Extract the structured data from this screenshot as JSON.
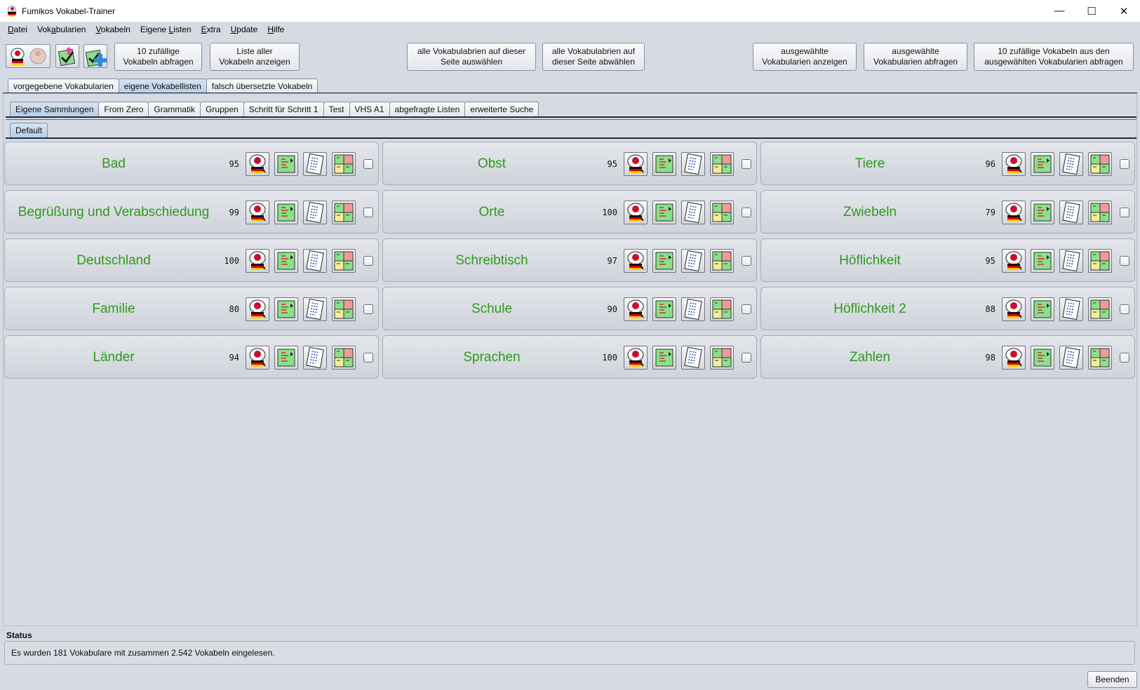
{
  "window": {
    "title": "Fumikos Vokabel-Trainer",
    "controls": [
      "—",
      "☐",
      "✕"
    ]
  },
  "menu": [
    {
      "pre": "",
      "u": "D",
      "post": "atei"
    },
    {
      "pre": "Vok",
      "u": "a",
      "post": "bularien"
    },
    {
      "pre": "",
      "u": "V",
      "post": "okabeln"
    },
    {
      "pre": "Eigene ",
      "u": "L",
      "post": "isten"
    },
    {
      "pre": "",
      "u": "E",
      "post": "xtra"
    },
    {
      "pre": "",
      "u": "U",
      "post": "pdate"
    },
    {
      "pre": "",
      "u": "H",
      "post": "ilfe"
    }
  ],
  "toolbar": {
    "icons": [
      "translate-quiz-icon",
      "import-icon",
      "add-list-icon"
    ],
    "random_quiz": [
      "10 zufällige",
      "Vokabeln abfragen"
    ],
    "list_all": [
      "Liste aller",
      "Vokabeln anzeigen"
    ],
    "select_all": [
      "alle Vokabulabrien auf dieser",
      "Seite auswählen"
    ],
    "deselect_all": [
      "alle Vokabulabrien auf",
      "dieser Seite abwählen"
    ],
    "show_selected": [
      "ausgewählte",
      "Vokabularien anzeigen"
    ],
    "quiz_selected": [
      "ausgewählte",
      "Vokabularien abfragen"
    ],
    "random_selected": [
      "10 zufällige Vokabeln aus den",
      "ausgewählten Vokabularien abfragen"
    ]
  },
  "main_tabs": [
    "vorgegebene Vokabularien",
    "eigene Vokabellisten",
    "falsch übersetzte Vokabeln"
  ],
  "main_tab_active": 1,
  "sub_tabs": [
    "Eigene Sammlungen",
    "From Zero",
    "Grammatik",
    "Gruppen",
    "Schritt für Schritt 1",
    "Test",
    "VHS A1",
    "abgefragte Listen",
    "erweiterte Suche"
  ],
  "sub_tab_active": 0,
  "inner_tabs": [
    "Default"
  ],
  "cards": [
    {
      "name": "Bad",
      "count": "95"
    },
    {
      "name": "Obst",
      "count": "95"
    },
    {
      "name": "Tiere",
      "count": "96"
    },
    {
      "name": "Begrüßung und Verabschiedung",
      "count": "99"
    },
    {
      "name": "Orte",
      "count": "100"
    },
    {
      "name": "Zwiebeln",
      "count": "79"
    },
    {
      "name": "Deutschland",
      "count": "100"
    },
    {
      "name": "Schreibtisch",
      "count": "97"
    },
    {
      "name": "Höflichkeit",
      "count": "95"
    },
    {
      "name": "Familie",
      "count": "80"
    },
    {
      "name": "Schule",
      "count": "90"
    },
    {
      "name": "Höflichkeit 2",
      "count": "88"
    },
    {
      "name": "Länder",
      "count": "94"
    },
    {
      "name": "Sprachen",
      "count": "100"
    },
    {
      "name": "Zahlen",
      "count": "98"
    }
  ],
  "card_icons": [
    "quiz-jp-de-icon",
    "flashcard-icon",
    "list-icon",
    "matching-icon"
  ],
  "status": {
    "label": "Status",
    "text": "Es wurden 181 Vokabulare mit zusammen 2.542 Vokabeln eingelesen."
  },
  "quit_label": "Beenden",
  "colors": {
    "card_title": "#2e9a1c",
    "tab_active": "#c3d5ea",
    "background": "#d6dae2"
  }
}
